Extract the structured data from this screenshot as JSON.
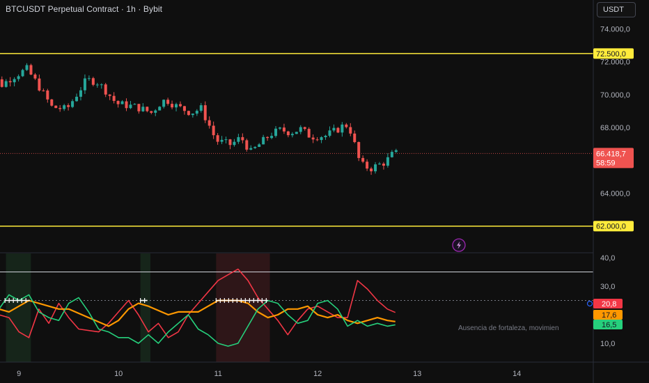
{
  "header": {
    "title": "BTCUSDT Perpetual Contract · 1h · Bybit"
  },
  "currency_button": {
    "label": "USDT"
  },
  "colors": {
    "up": "#26a69a",
    "down": "#ef5350",
    "level": "#ffeb3b",
    "adx": "#ff9800",
    "di_plus": "#26d07c",
    "di_minus": "#f23645",
    "background": "#0f0f0f"
  },
  "chart_data": [
    {
      "type": "candlestick",
      "symbol": "BTCUSDT Perpetual Contract · 1h · Bybit",
      "ylim": [
        62500,
        74800
      ],
      "xlim": [
        8.6,
        14.2
      ],
      "y_ticks": [
        {
          "value": 74000,
          "label": "74.000,0"
        },
        {
          "value": 72000,
          "label": "72.000,0"
        },
        {
          "value": 70000,
          "label": "70.000,0"
        },
        {
          "value": 68000,
          "label": "68.000,0"
        },
        {
          "value": 64000,
          "label": "64.000,0"
        },
        {
          "value": 62000,
          "label": "62.000,0"
        }
      ],
      "x_ticks": [
        {
          "value": 9,
          "label": "9"
        },
        {
          "value": 10,
          "label": "10"
        },
        {
          "value": 11,
          "label": "11"
        },
        {
          "value": 12,
          "label": "12"
        },
        {
          "value": 13,
          "label": "13"
        },
        {
          "value": 14,
          "label": "14"
        }
      ],
      "horizontal_levels": [
        {
          "value": 72500,
          "label": "72.500,0"
        },
        {
          "value": 62000,
          "label": "62.000,0"
        }
      ],
      "last_price": {
        "value": 66418.7,
        "label": "66.418,7",
        "countdown": "58:59"
      },
      "waypoints": [
        [
          8.6,
          71350
        ],
        [
          8.7,
          71500
        ],
        [
          8.85,
          70600
        ],
        [
          8.95,
          71050
        ],
        [
          9.1,
          71550
        ],
        [
          9.2,
          70700
        ],
        [
          9.35,
          69250
        ],
        [
          9.5,
          69100
        ],
        [
          9.7,
          70900
        ],
        [
          9.8,
          70800
        ],
        [
          9.9,
          70200
        ],
        [
          10.0,
          69450
        ],
        [
          10.2,
          69250
        ],
        [
          10.35,
          68900
        ],
        [
          10.45,
          69550
        ],
        [
          10.5,
          69700
        ],
        [
          10.6,
          69300
        ],
        [
          10.75,
          68900
        ],
        [
          10.85,
          69150
        ],
        [
          10.95,
          67900
        ],
        [
          11.0,
          67200
        ],
        [
          11.15,
          66950
        ],
        [
          11.25,
          67400
        ],
        [
          11.35,
          66500
        ],
        [
          11.45,
          67050
        ],
        [
          11.55,
          67600
        ],
        [
          11.65,
          67850
        ],
        [
          11.75,
          67700
        ],
        [
          11.85,
          67900
        ],
        [
          11.95,
          67450
        ],
        [
          12.1,
          67500
        ],
        [
          12.2,
          67800
        ],
        [
          12.3,
          68200
        ],
        [
          12.35,
          67800
        ],
        [
          12.4,
          66800
        ],
        [
          12.45,
          65750
        ],
        [
          12.55,
          65500
        ],
        [
          12.7,
          65900
        ],
        [
          12.78,
          66420
        ]
      ]
    },
    {
      "type": "line",
      "indicator": "DMI / ADX",
      "ylim": [
        4,
        40
      ],
      "y_ticks": [
        {
          "value": 40,
          "label": "40,0"
        },
        {
          "value": 30,
          "label": "30,0"
        },
        {
          "value": 10,
          "label": "10,0"
        }
      ],
      "reference_levels": [
        35,
        25
      ],
      "value_tags": [
        {
          "value": 20.8,
          "label": "20,8"
        },
        {
          "value": 17.6,
          "label": "17,6"
        },
        {
          "value": 16.5,
          "label": "16,5"
        }
      ],
      "annotation": "Ausencia de fortaleza, movimien",
      "series": [
        {
          "key": "di_minus",
          "points": [
            [
              8.6,
              12
            ],
            [
              8.8,
              20
            ],
            [
              8.9,
              19
            ],
            [
              9.0,
              14
            ],
            [
              9.1,
              12
            ],
            [
              9.2,
              22
            ],
            [
              9.3,
              17
            ],
            [
              9.4,
              24
            ],
            [
              9.5,
              19
            ],
            [
              9.6,
              15
            ],
            [
              9.8,
              14
            ],
            [
              9.9,
              17
            ],
            [
              10.0,
              21
            ],
            [
              10.1,
              25
            ],
            [
              10.2,
              20
            ],
            [
              10.3,
              14
            ],
            [
              10.4,
              17
            ],
            [
              10.5,
              12
            ],
            [
              10.6,
              14
            ],
            [
              10.7,
              20
            ],
            [
              10.8,
              24
            ],
            [
              10.9,
              28
            ],
            [
              11.0,
              32
            ],
            [
              11.1,
              34
            ],
            [
              11.2,
              36
            ],
            [
              11.3,
              32
            ],
            [
              11.4,
              26
            ],
            [
              11.5,
              22
            ],
            [
              11.6,
              18
            ],
            [
              11.7,
              13
            ],
            [
              11.8,
              18
            ],
            [
              11.9,
              22
            ],
            [
              12.0,
              23
            ],
            [
              12.2,
              19
            ],
            [
              12.3,
              19
            ],
            [
              12.4,
              32
            ],
            [
              12.5,
              29
            ],
            [
              12.6,
              25
            ],
            [
              12.7,
              22
            ],
            [
              12.78,
              20.8
            ]
          ]
        },
        {
          "key": "adx",
          "points": [
            [
              8.6,
              20
            ],
            [
              8.7,
              23
            ],
            [
              8.9,
              21
            ],
            [
              9.0,
              23
            ],
            [
              9.1,
              25
            ],
            [
              9.2,
              24
            ],
            [
              9.4,
              22
            ],
            [
              9.5,
              22
            ],
            [
              9.7,
              19
            ],
            [
              9.9,
              16
            ],
            [
              10.0,
              18
            ],
            [
              10.1,
              22
            ],
            [
              10.2,
              24
            ],
            [
              10.3,
              23
            ],
            [
              10.5,
              20
            ],
            [
              10.6,
              21
            ],
            [
              10.7,
              21
            ],
            [
              10.8,
              21
            ],
            [
              10.9,
              23
            ],
            [
              11.0,
              25
            ],
            [
              11.1,
              25
            ],
            [
              11.2,
              25
            ],
            [
              11.3,
              24
            ],
            [
              11.4,
              21
            ],
            [
              11.5,
              19
            ],
            [
              11.6,
              20
            ],
            [
              11.7,
              22
            ],
            [
              11.8,
              22
            ],
            [
              11.9,
              23
            ],
            [
              12.0,
              20
            ],
            [
              12.1,
              19
            ],
            [
              12.2,
              20
            ],
            [
              12.3,
              18
            ],
            [
              12.4,
              17
            ],
            [
              12.5,
              18
            ],
            [
              12.6,
              19
            ],
            [
              12.7,
              18
            ],
            [
              12.78,
              17.6
            ]
          ]
        },
        {
          "key": "di_plus",
          "points": [
            [
              8.6,
              28
            ],
            [
              8.7,
              26
            ],
            [
              8.8,
              22
            ],
            [
              8.9,
              27
            ],
            [
              9.0,
              25
            ],
            [
              9.1,
              27
            ],
            [
              9.2,
              21
            ],
            [
              9.3,
              19
            ],
            [
              9.4,
              18
            ],
            [
              9.5,
              24
            ],
            [
              9.6,
              26
            ],
            [
              9.7,
              21
            ],
            [
              9.8,
              15
            ],
            [
              9.9,
              14
            ],
            [
              10.0,
              12
            ],
            [
              10.1,
              12
            ],
            [
              10.2,
              10
            ],
            [
              10.3,
              13
            ],
            [
              10.4,
              10
            ],
            [
              10.5,
              14
            ],
            [
              10.6,
              17
            ],
            [
              10.7,
              20
            ],
            [
              10.8,
              15
            ],
            [
              10.9,
              13
            ],
            [
              11.0,
              10
            ],
            [
              11.1,
              9
            ],
            [
              11.2,
              10
            ],
            [
              11.3,
              16
            ],
            [
              11.4,
              22
            ],
            [
              11.5,
              25
            ],
            [
              11.6,
              24
            ],
            [
              11.7,
              20
            ],
            [
              11.8,
              17
            ],
            [
              11.9,
              18
            ],
            [
              12.0,
              24
            ],
            [
              12.1,
              25
            ],
            [
              12.2,
              22
            ],
            [
              12.3,
              16
            ],
            [
              12.4,
              18
            ],
            [
              12.5,
              16
            ],
            [
              12.6,
              17
            ],
            [
              12.7,
              16
            ],
            [
              12.78,
              16.5
            ]
          ]
        }
      ],
      "shaded_ranges": [
        {
          "from": 8.87,
          "to": 9.12
        },
        {
          "from": 10.22,
          "to": 10.32
        },
        {
          "from": 10.98,
          "to": 11.52
        }
      ],
      "cross_markers": [
        {
          "from": 8.86,
          "to": 9.11
        },
        {
          "from": 10.22,
          "to": 10.29
        },
        {
          "from": 10.98,
          "to": 11.5
        }
      ]
    }
  ]
}
